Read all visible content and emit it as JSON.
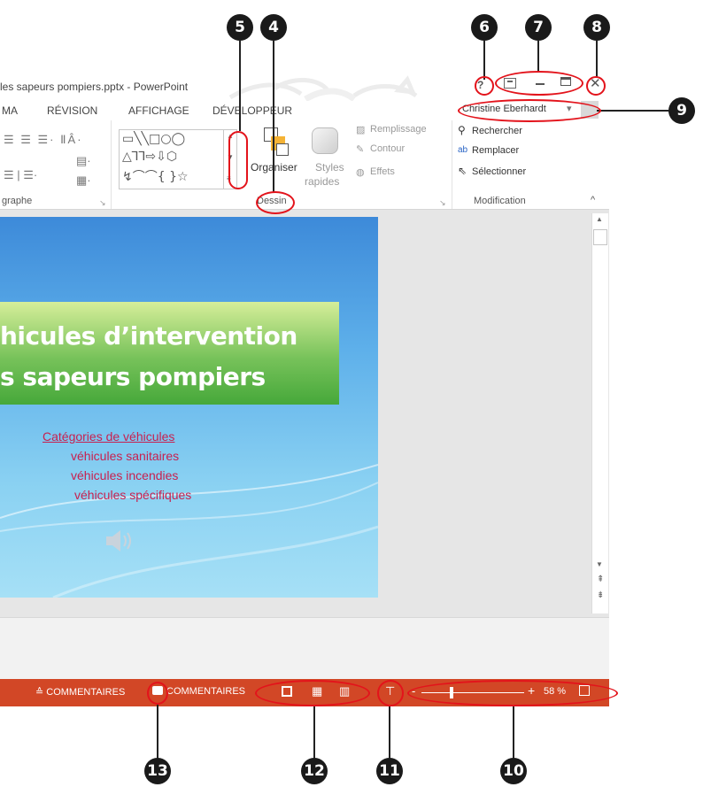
{
  "window": {
    "title": "les sapeurs pompiers.pptx - PowerPoint",
    "help_label": "?",
    "user_name": "Christine Eberhardt",
    "user_caret": "▾"
  },
  "tabs": [
    "MA",
    "RÉVISION",
    "AFFICHAGE",
    "DÉVELOPPEUR"
  ],
  "ribbon": {
    "paragraph_group_label": "graphe",
    "drawing_group_label": "Dessin",
    "modification_group_label": "Modification",
    "organiser_label": "Organiser",
    "styles_label_1": "Styles",
    "styles_label_2": "rapides",
    "remplissage_label": "Remplissage",
    "contour_label": "Contour",
    "effets_label": "Effets",
    "rechercher_label": "Rechercher",
    "remplacer_label": "Remplacer",
    "selectionner_label": "Sélectionner",
    "shapes_row1": "▭╲╲□○◯",
    "shapes_row2": "△⅂⅂⇨⇩⬡",
    "shapes_row3": "↯⌒⌒{ }☆"
  },
  "slide": {
    "title_line_1": "hicules d’intervention",
    "title_line_2": "s sapeurs pompiers",
    "link_label": "Catégories de véhicules",
    "items": [
      "véhicules sanitaires",
      "véhicules incendies",
      "véhicules spécifiques"
    ]
  },
  "statusbar": {
    "notes_label": "≙ COMMENTAIRES",
    "comments_label": "COMMENTAIRES",
    "zoom_minus": "-",
    "zoom_plus": "+",
    "zoom_level": "58 %"
  },
  "callouts": [
    "4",
    "5",
    "6",
    "7",
    "8",
    "9",
    "10",
    "11",
    "12",
    "13"
  ],
  "colors": {
    "status_bar": "#d24726",
    "callout_ring": "#e3131b",
    "slide_link": "#c8204f"
  }
}
